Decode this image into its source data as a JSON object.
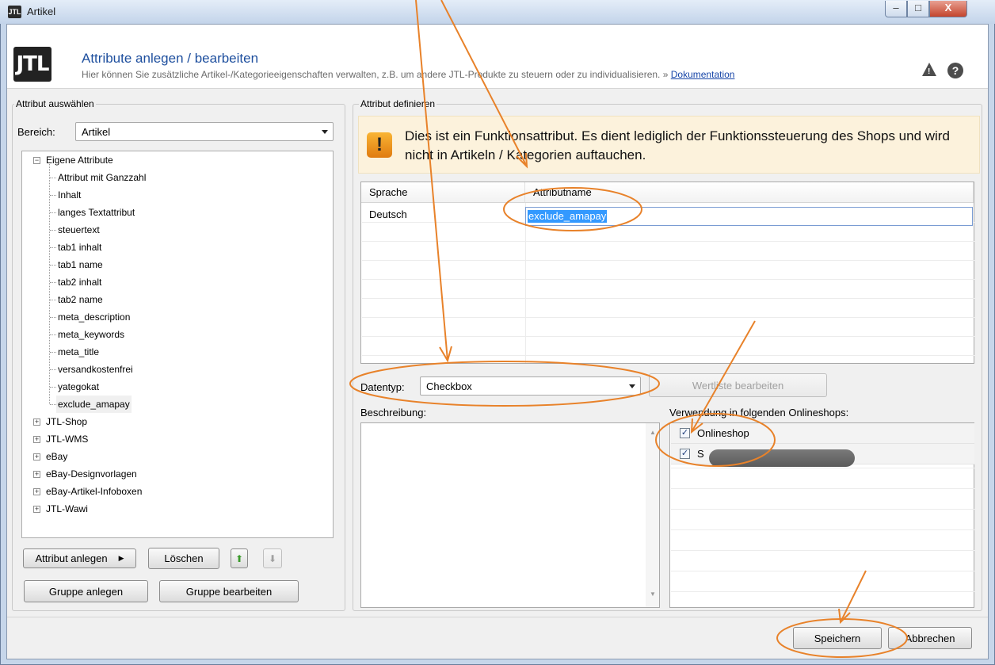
{
  "window": {
    "title": "Artikel",
    "icon": "JTL",
    "min": "–",
    "max": "□",
    "close": "X"
  },
  "header": {
    "logo": "JTL",
    "title": "Attribute anlegen / bearbeiten",
    "subtitle": "Hier können Sie zusätzliche Artikel-/Kategorieeigenschaften verwalten, z.B. um andere JTL-Produkte zu steuern oder zu individualisieren. »",
    "doc_link": "Dokumentation",
    "warn_icon": "warning-icon",
    "help_icon": "help-icon"
  },
  "left": {
    "group_label": "Attribut auswählen",
    "bereich_label": "Bereich:",
    "bereich_value": "Artikel",
    "tree": {
      "root": "Eigene Attribute",
      "children": [
        "Attribut mit Ganzzahl",
        "Inhalt",
        "langes Textattribut",
        "steuertext",
        "tab1 inhalt",
        "tab1 name",
        "tab2 inhalt",
        "tab2 name",
        "meta_description",
        "meta_keywords",
        "meta_title",
        "versandkostenfrei",
        "yategokat",
        "exclude_amapay"
      ],
      "groups": [
        "JTL-Shop",
        "JTL-WMS",
        "eBay",
        "eBay-Designvorlagen",
        "eBay-Artikel-Infoboxen",
        "JTL-Wawi"
      ]
    },
    "buttons": {
      "attr_anlegen": "Attribut anlegen",
      "loeschen": "Löschen",
      "gruppe_anlegen": "Gruppe anlegen",
      "gruppe_bearbeiten": "Gruppe bearbeiten"
    }
  },
  "right": {
    "group_label": "Attribut definieren",
    "info_text": "Dies ist ein Funktionsattribut. Es dient lediglich der Funktionssteuerung des Shops und wird nicht in Artikeln / Kategorien auftauchen.",
    "table": {
      "col_lang": "Sprache",
      "col_name": "Attributname",
      "row_lang": "Deutsch",
      "row_name": "exclude_amapay"
    },
    "datentyp_label": "Datentyp:",
    "datentyp_value": "Checkbox",
    "wertliste_button": "Wertliste bearbeiten",
    "beschreibung_label": "Beschreibung:",
    "shops_label": "Verwendung in folgenden Onlineshops:",
    "shops": [
      {
        "name": "Onlineshop",
        "checked": true
      },
      {
        "name": "S",
        "checked": true
      }
    ]
  },
  "footer": {
    "save": "Speichern",
    "cancel": "Abbrechen"
  },
  "colors": {
    "annotation": "#e8822a",
    "link": "#1846a8",
    "title": "#1e4f9e",
    "info_bg": "#fcf2dc"
  }
}
